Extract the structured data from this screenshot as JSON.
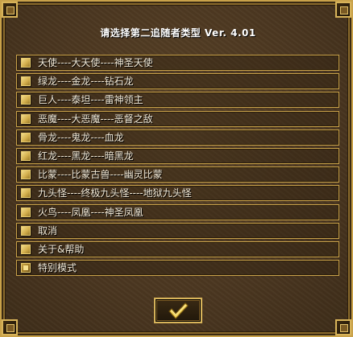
{
  "dialog": {
    "title": "请选择第二追随者类型  Ver. 4.01",
    "options": [
      {
        "label": "天使----大天使----神圣天使",
        "checked": false
      },
      {
        "label": "绿龙----金龙----钻石龙",
        "checked": false
      },
      {
        "label": "巨人----泰坦----雷神领主",
        "checked": false
      },
      {
        "label": "恶魔----大恶魔----恶督之敌",
        "checked": false
      },
      {
        "label": "骨龙----鬼龙----血龙",
        "checked": false
      },
      {
        "label": "红龙----黑龙----暗黑龙",
        "checked": false
      },
      {
        "label": "比蒙----比蒙古兽----幽灵比蒙",
        "checked": false
      },
      {
        "label": "九头怪----终极九头怪----地狱九头怪",
        "checked": false
      },
      {
        "label": "火鸟----凤凰----神圣凤凰",
        "checked": false
      },
      {
        "label": "取消",
        "checked": false
      },
      {
        "label": "关于&帮助",
        "checked": false
      },
      {
        "label": "特别模式",
        "checked": true
      }
    ],
    "ok_icon": "checkmark-icon"
  }
}
